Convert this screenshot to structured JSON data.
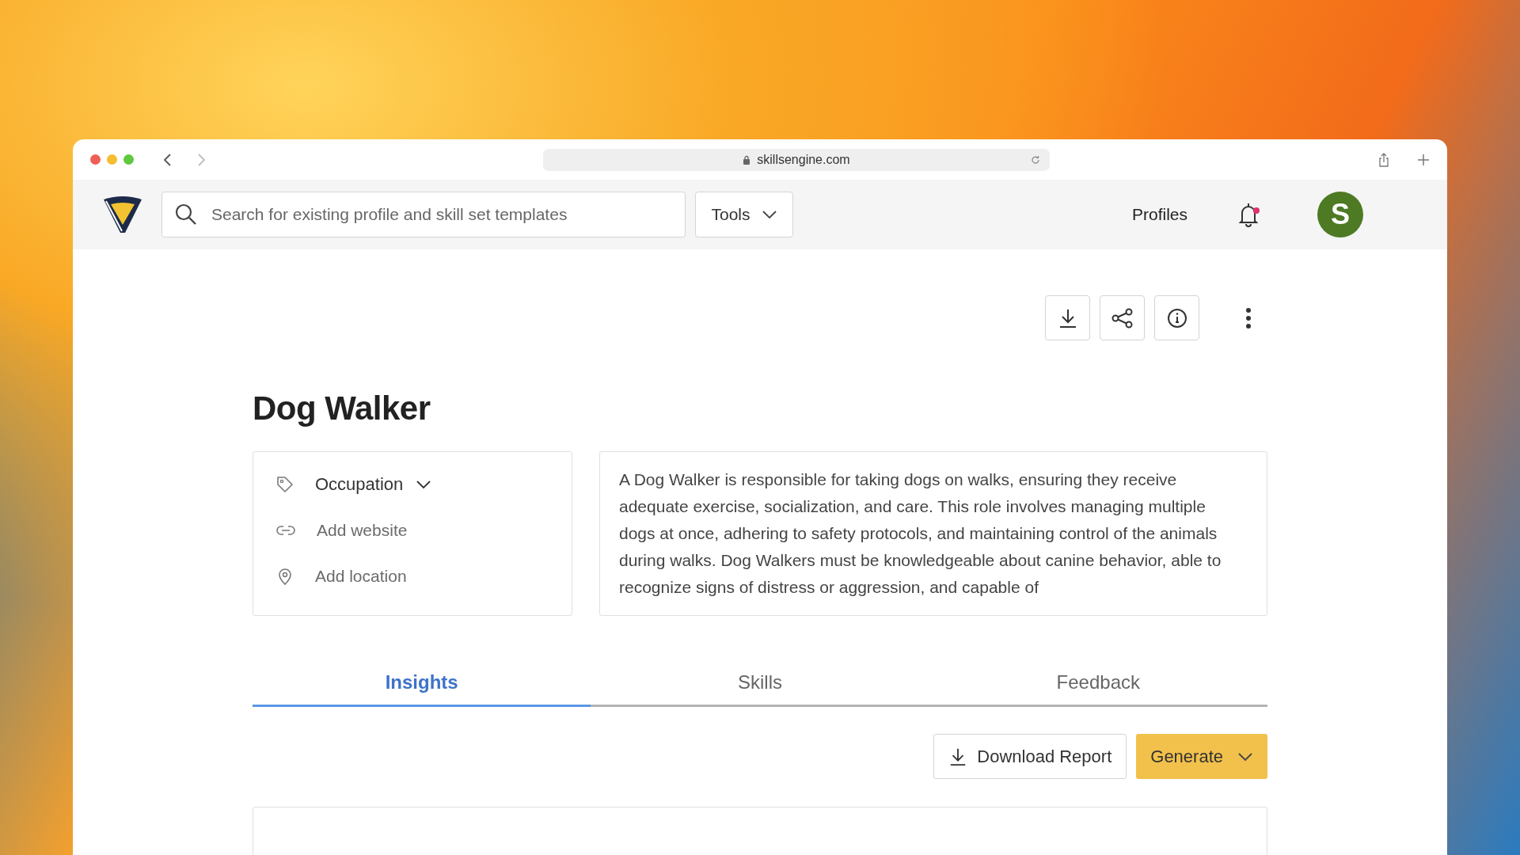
{
  "browser": {
    "url": "skillsengine.com"
  },
  "header": {
    "search": {
      "placeholder": "Search for existing profile and skill set templates"
    },
    "tools_menu": "Tools",
    "nav_link": "Profiles",
    "notification_unread": true,
    "avatar_initial": "S"
  },
  "profile": {
    "title": "Dog Walker",
    "meta": [
      {
        "kind": "occupation",
        "label": "Occupation"
      },
      {
        "kind": "website",
        "label": "Add website"
      },
      {
        "kind": "location",
        "label": "Add location"
      }
    ],
    "description": "A Dog Walker is responsible for taking dogs on walks, ensuring they receive adequate exercise, socialization, and care. This role involves managing multiple dogs at once, adhering to safety protocols, and maintaining control of the animals during walks. Dog Walkers must be knowledgeable about canine behavior, able to recognize signs of distress or aggression, and capable of"
  },
  "tabs": [
    {
      "label": "Insights",
      "selected": true
    },
    {
      "label": "Skills",
      "selected": false
    },
    {
      "label": "Feedback",
      "selected": false
    }
  ],
  "actions": {
    "download": "Download Report",
    "generate": "Generate"
  }
}
